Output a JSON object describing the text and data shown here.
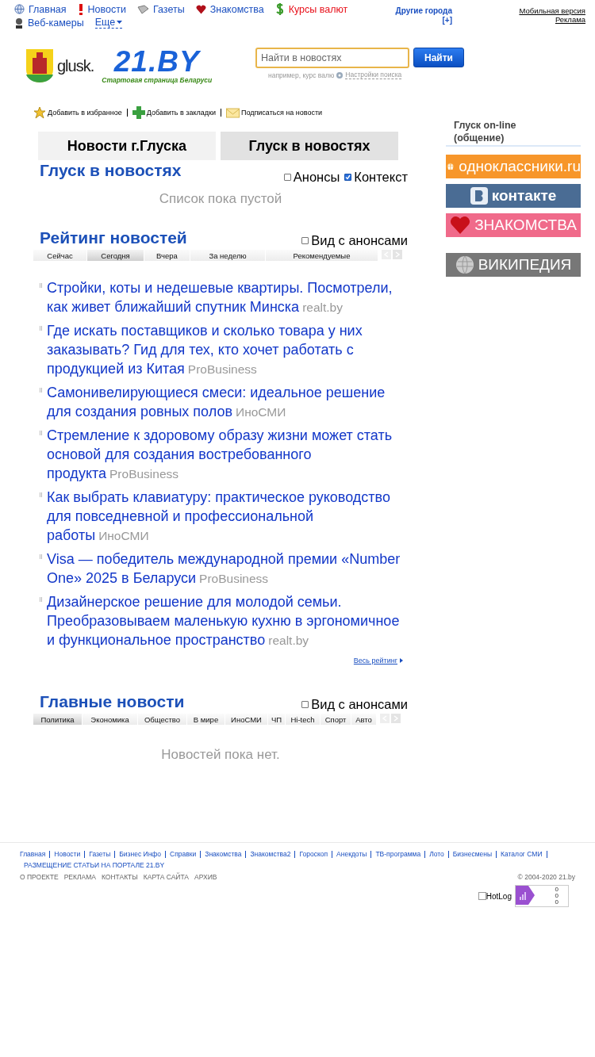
{
  "top_nav": [
    {
      "label": "Главная",
      "kind": "globe",
      "color": "#1a4fc0"
    },
    {
      "label": "Новости",
      "kind": "exclaim",
      "color": "#1a4fc0"
    },
    {
      "label": "Газеты",
      "kind": "paper",
      "color": "#1a4fc0"
    },
    {
      "label": "Знакомства",
      "kind": "heart",
      "color": "#1a4fc0"
    },
    {
      "label": "Курсы валют",
      "kind": "dollar",
      "color": "#e8101a"
    },
    {
      "label": "Веб-камеры",
      "kind": "webcam",
      "color": "#1a4fc0"
    }
  ],
  "more_menu": "Еще",
  "other_cities": {
    "label": "Другие города",
    "toggle": "[+]"
  },
  "top_right_links": [
    "Мобильная версия",
    "Реклама"
  ],
  "logo": {
    "city": "glusk.",
    "brand": "21.BY",
    "slogan": "Стартовая страница Беларуси"
  },
  "search": {
    "placeholder": "Найти в новостях",
    "button": "Найти",
    "hint": "например, курс валю",
    "settings": "Настройки поиска"
  },
  "actions": [
    {
      "label": "Добавить в избранное",
      "kind": "star"
    },
    {
      "label": "Добавить в закладки",
      "kind": "plus"
    },
    {
      "label": "Подписаться на новости",
      "kind": "mail"
    }
  ],
  "tabs": [
    {
      "label": "Новости г.Глуска",
      "selected": false
    },
    {
      "label": "Глуск в новостях",
      "selected": true
    }
  ],
  "city_news": {
    "title": "Глуск в новостях",
    "options": [
      {
        "label": "Анонсы",
        "checked": false
      },
      {
        "label": "Контекст",
        "checked": true
      }
    ],
    "empty": "Список пока пустой"
  },
  "rating": {
    "title": "Рейтинг новостей",
    "option": {
      "label": "Вид с анонсами",
      "checked": false
    },
    "periods": [
      {
        "label": "Сейчас",
        "selected": false
      },
      {
        "label": "Сегодня",
        "selected": true
      },
      {
        "label": "Вчера",
        "selected": false
      },
      {
        "label": "За неделю",
        "selected": false
      },
      {
        "label": "Рекомендуемые",
        "selected": false
      }
    ],
    "items": [
      {
        "title": "Стройки, коты и недешевые квартиры. Посмотрели, как живет ближайший спутник Минска",
        "source": "realt.by"
      },
      {
        "title": "Где искать поставщиков и сколько товара у них заказывать? Гид для тех, кто хочет работать с продукцией из Китая",
        "source": "ProBusiness"
      },
      {
        "title": "Самонивелирующиеся смеси: идеальное решение для создания ровных полов",
        "source": "ИноСМИ"
      },
      {
        "title": "Стремление к здоровому образу жизни может стать основой для создания востребованного продукта",
        "source": "ProBusiness"
      },
      {
        "title": "Как выбрать клавиатуру: практическое руководство для повседневной и профессиональной работы",
        "source": "ИноСМИ"
      },
      {
        "title": "Visa — победитель международной премии «Number One» 2025 в Беларуси",
        "source": "ProBusiness"
      },
      {
        "title": "Дизайнерское решение для молодой семьи. Преобразовываем маленькую кухню в эргономичное и функциональное пространство",
        "source": "realt.by"
      }
    ],
    "more": "Весь рейтинг"
  },
  "main_news": {
    "title": "Главные новости",
    "option": {
      "label": "Вид с анонсами",
      "checked": false
    },
    "categories": [
      {
        "label": "Политика",
        "selected": true
      },
      {
        "label": "Экономика",
        "selected": false
      },
      {
        "label": "Общество",
        "selected": false
      },
      {
        "label": "В мире",
        "selected": false
      },
      {
        "label": "ИноСМИ",
        "selected": false
      },
      {
        "label": "ЧП",
        "selected": false
      },
      {
        "label": "Hi-tech",
        "selected": false
      },
      {
        "label": "Спорт",
        "selected": false
      },
      {
        "label": "Авто",
        "selected": false
      }
    ],
    "empty": "Новостей пока нет."
  },
  "sidebar": {
    "title": "Глуск on-line (общение)",
    "banners": [
      {
        "label": "одноклассники.ru",
        "kind": "ok"
      },
      {
        "label": "контакте",
        "kind": "vk"
      },
      {
        "label": "ЗНАКОМСТВА",
        "kind": "dating"
      },
      {
        "label": "ВИКИПЕДИЯ",
        "kind": "wiki"
      }
    ]
  },
  "footer": {
    "links": [
      "Главная",
      "Новости",
      "Газеты",
      "Бизнес Инфо",
      "Справки",
      "Знакомства",
      "Знакомства2",
      "Гороскоп",
      "Анекдоты",
      "ТВ-программа",
      "Лото",
      "Бизнесмены",
      "Каталог СМИ"
    ],
    "placement_link": "РАЗМЕЩЕНИЕ СТАТЬИ НА ПОРТАЛЕ 21.BY",
    "info_links": [
      "О ПРОЕКТЕ",
      "РЕКЛАМА",
      "КОНТАКТЫ",
      "КАРТА САЙТА",
      "АРХИВ"
    ],
    "copyright": "© 2004-2020 21.by",
    "counter": "HotLog",
    "counter_values": [
      "0",
      "0",
      "0"
    ]
  }
}
